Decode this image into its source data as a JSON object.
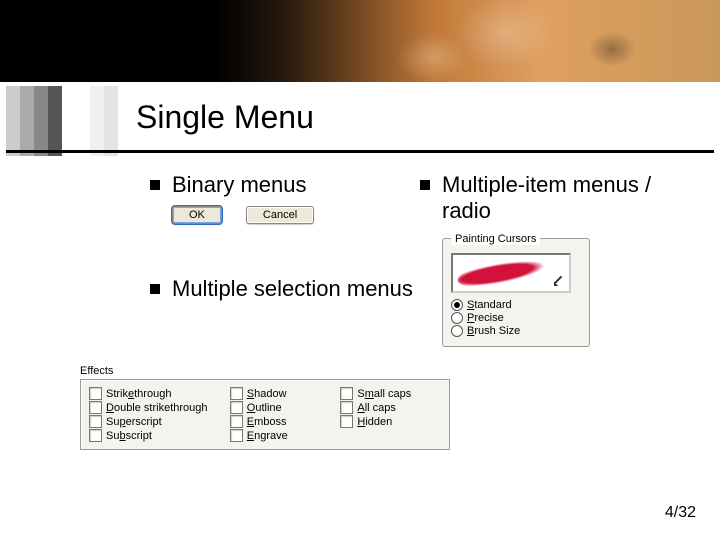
{
  "title": "Single Menu",
  "bullets": {
    "binary": "Binary menus",
    "multi_item": "Multiple-item menus / radio",
    "multi_select": "Multiple selection menus"
  },
  "binary_buttons": {
    "ok": "OK",
    "cancel": "Cancel"
  },
  "radio_group": {
    "legend": "Painting Cursors",
    "options": [
      {
        "label": "Standard",
        "checked": true
      },
      {
        "label": "Precise",
        "checked": false
      },
      {
        "label": "Brush Size",
        "checked": false
      }
    ]
  },
  "effects": {
    "label": "Effects",
    "columns": [
      [
        "Strikethrough",
        "Double strikethrough",
        "Superscript",
        "Subscript"
      ],
      [
        "Shadow",
        "Outline",
        "Emboss",
        "Engrave"
      ],
      [
        "Small caps",
        "All caps",
        "Hidden"
      ]
    ]
  },
  "page": "4/32"
}
